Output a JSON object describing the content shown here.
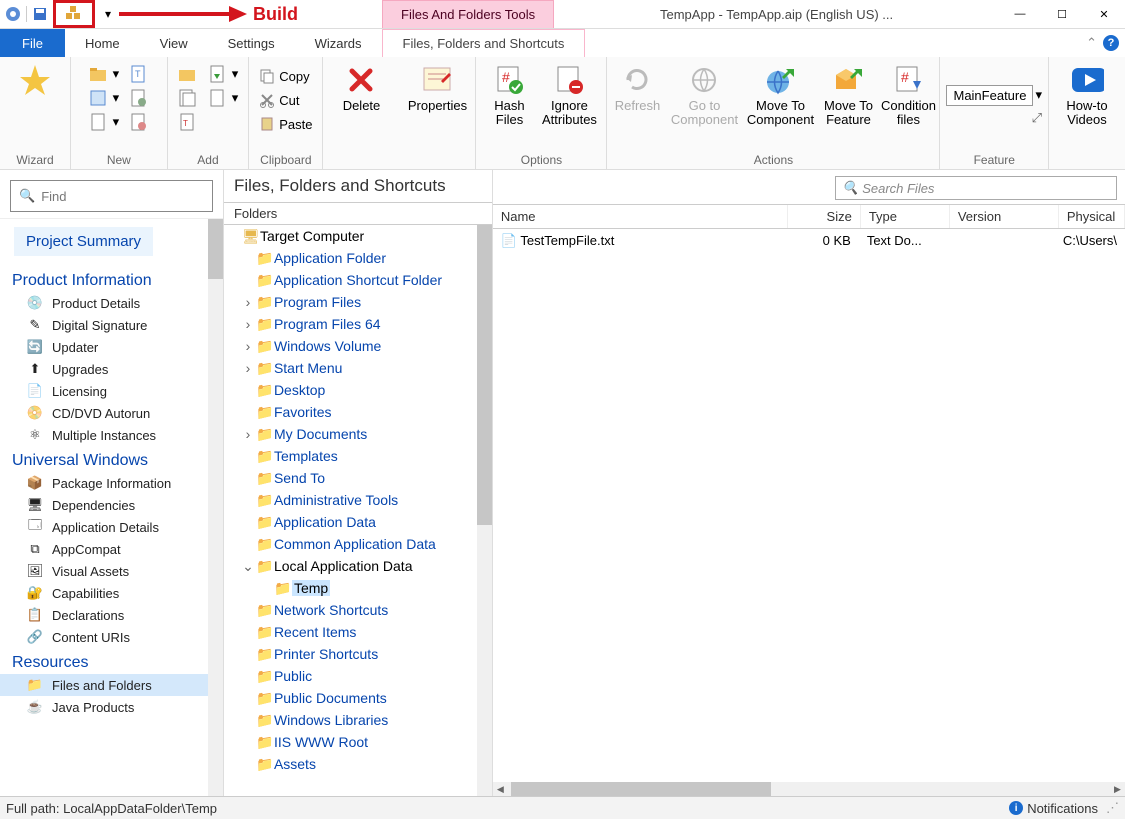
{
  "annotation": {
    "build_label": "Build"
  },
  "title": {
    "context_tab": "Files And Folders Tools",
    "document": "TempApp - TempApp.aip (English US) ..."
  },
  "tabs": {
    "file": "File",
    "home": "Home",
    "view": "View",
    "settings": "Settings",
    "wizards": "Wizards",
    "files": "Files, Folders and Shortcuts"
  },
  "ribbon": {
    "wizard_group": "Wizard",
    "new_group": "New",
    "add_group": "Add",
    "clipboard_group": "Clipboard",
    "copy": "Copy",
    "cut": "Cut",
    "paste": "Paste",
    "delete": "Delete",
    "properties": "Properties",
    "options_group": "Options",
    "hash": "Hash Files",
    "ignore": "Ignore Attributes",
    "refresh": "Refresh",
    "goto": "Go to Component",
    "actions_group": "Actions",
    "mtc": "Move To Component",
    "mtf": "Move To Feature",
    "cond": "Condition files",
    "feature_group": "Feature",
    "feature_sel": "MainFeature",
    "videos": "How-to Videos"
  },
  "sidebar": {
    "find_placeholder": "Find",
    "summary": "Project Summary",
    "cats": {
      "product": "Product Information",
      "uw": "Universal Windows",
      "res": "Resources"
    },
    "items": {
      "pd": "Product Details",
      "ds": "Digital Signature",
      "up": "Updater",
      "ug": "Upgrades",
      "lic": "Licensing",
      "cd": "CD/DVD Autorun",
      "mi": "Multiple Instances",
      "pi": "Package Information",
      "dep": "Dependencies",
      "ad": "Application Details",
      "ac": "AppCompat",
      "va": "Visual Assets",
      "cap": "Capabilities",
      "dec": "Declarations",
      "cu": "Content URIs",
      "ff": "Files and Folders",
      "jp": "Java Products"
    }
  },
  "mid": {
    "title": "Files, Folders and Shortcuts",
    "folders_hd": "Folders",
    "tree": {
      "root": "Target Computer",
      "items": [
        "Application Folder",
        "Application Shortcut Folder",
        "Program Files",
        "Program Files 64",
        "Windows Volume",
        "Start Menu",
        "Desktop",
        "Favorites",
        "My Documents",
        "Templates",
        "Send To",
        "Administrative Tools",
        "Application Data",
        "Common Application Data",
        "Local Application Data",
        "Temp",
        "Network Shortcuts",
        "Recent Items",
        "Printer Shortcuts",
        "Public",
        "Public Documents",
        "Windows Libraries",
        "IIS WWW Root",
        "Assets"
      ]
    }
  },
  "right": {
    "search_placeholder": "Search Files",
    "cols": {
      "name": "Name",
      "size": "Size",
      "type": "Type",
      "ver": "Version",
      "phys": "Physical"
    },
    "row": {
      "name": "TestTempFile.txt",
      "size": "0 KB",
      "type": "Text Do...",
      "ver": "",
      "phys": "C:\\Users\\"
    }
  },
  "status": {
    "path": "Full path: LocalAppDataFolder\\Temp",
    "notif": "Notifications"
  }
}
